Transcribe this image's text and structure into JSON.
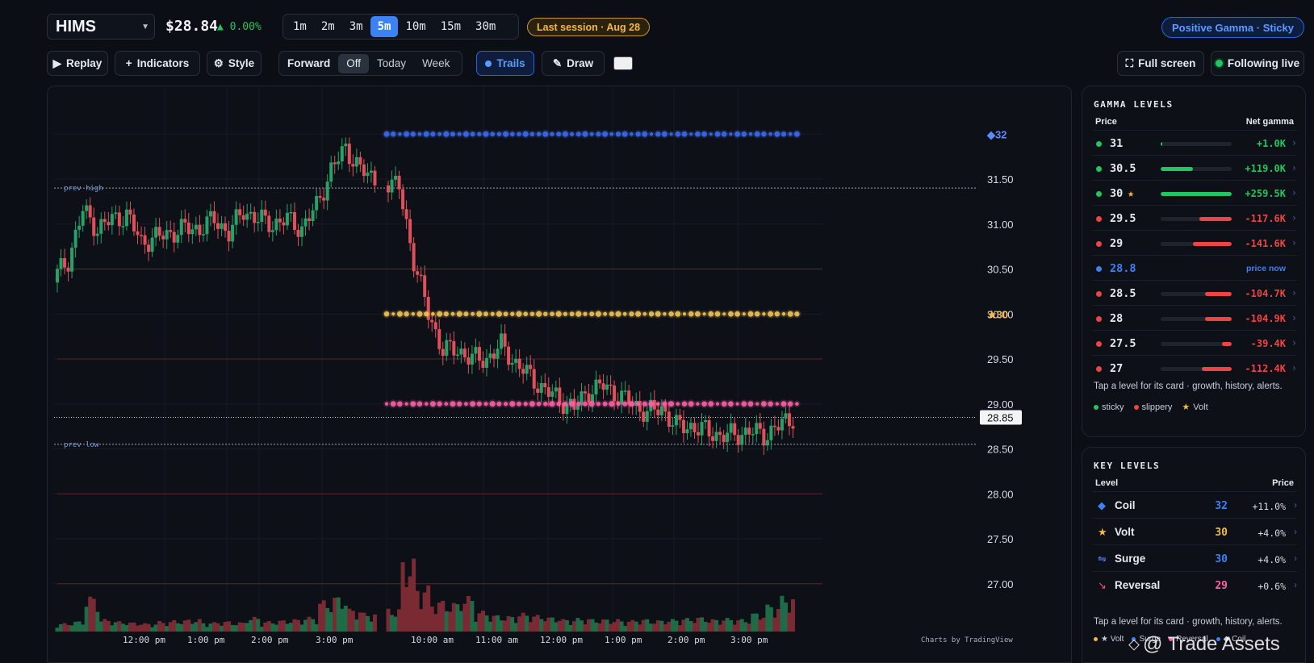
{
  "header": {
    "symbol": "HIMS",
    "price": "$28.84",
    "change": "▲ 0.00%",
    "timeframes": [
      "1m",
      "2m",
      "3m",
      "5m",
      "10m",
      "15m",
      "30m"
    ],
    "active_timeframe": "5m",
    "session_badge": "Last session · Aug 28",
    "regime_badge": "Positive Gamma · Sticky"
  },
  "toolbar": {
    "replay": "Replay",
    "indicators": "Indicators",
    "style": "Style",
    "forward_label": "Forward",
    "forward_options": [
      "Off",
      "Today",
      "Week"
    ],
    "forward_selected": "Off",
    "trails": "Trails",
    "draw": "Draw",
    "fullscreen": "Full screen",
    "following": "Following live"
  },
  "chart": {
    "attribution": "Charts by TradingView",
    "prev_high_label": "prev high",
    "prev_low_label": "prev low",
    "last_price_tag": "28.85",
    "level_tags": [
      {
        "text": "32",
        "prefix": "◆",
        "color": "#5b8cff"
      },
      {
        "text": "30",
        "prefix": "★",
        "color": "#f5b942"
      }
    ]
  },
  "chart_data": {
    "type": "candlestick",
    "price_axis_ticks": [
      "31.50",
      "31.00",
      "30.50",
      "30.00",
      "29.50",
      "29.00",
      "28.50",
      "28.00",
      "27.50",
      "27.00"
    ],
    "price_axis_values": [
      31.5,
      31.0,
      30.5,
      30.0,
      29.5,
      29.0,
      28.5,
      28.0,
      27.5,
      27.0
    ],
    "time_axis_labels": [
      "12:00 pm",
      "1:00 pm",
      "2:00 pm",
      "3:00 pm",
      "10:00 am",
      "11:00 am",
      "12:00 pm",
      "1:00 pm",
      "2:00 pm",
      "3:00 pm"
    ],
    "ylim": [
      26.5,
      32.6
    ],
    "prev_high": 31.4,
    "prev_low": 28.55,
    "last_price": 28.85,
    "gamma_trails": [
      {
        "name": "32",
        "price": 32.0,
        "color": "#3b6cf0"
      },
      {
        "name": "30",
        "price": 30.0,
        "color": "#f5c451"
      },
      {
        "name": "29",
        "price": 29.0,
        "color": "#ff5fa8"
      }
    ],
    "red_levels": [
      29.5,
      28.0,
      27.0
    ],
    "green_levels": [
      30.5
    ],
    "close_path": [
      30.4,
      30.6,
      31.15,
      30.95,
      31.05,
      31.1,
      30.8,
      30.85,
      30.9,
      30.95,
      30.95,
      31.05,
      30.9,
      31.15,
      31.05,
      31.0,
      31.05,
      30.95,
      31.2,
      31.6,
      31.85,
      31.6,
      31.5,
      31.4,
      30.6,
      30.0,
      29.6,
      29.6,
      29.5,
      29.5,
      29.65,
      29.45,
      29.3,
      29.15,
      29.05,
      28.95,
      29.15,
      29.2,
      29.1,
      29.0,
      28.9,
      28.95,
      28.75,
      28.75,
      28.7,
      28.65,
      28.65,
      28.7,
      28.65,
      28.75,
      28.85
    ],
    "volume_profile": [
      8,
      10,
      34,
      12,
      10,
      9,
      8,
      10,
      11,
      12,
      9,
      10,
      9,
      14,
      10,
      11,
      12,
      14,
      30,
      34,
      22,
      18,
      22,
      70,
      44,
      30,
      28,
      34,
      20,
      16,
      15,
      18,
      16,
      14,
      12,
      13,
      12,
      12,
      11,
      12,
      11,
      12,
      13,
      14,
      12,
      13,
      12,
      18,
      26,
      34,
      90
    ]
  },
  "gamma_levels": {
    "title": "GAMMA LEVELS",
    "col_price": "Price",
    "col_net": "Net gamma",
    "rows": [
      {
        "price": "31",
        "value": "+1.0K",
        "side": "pos",
        "fill": 0.02,
        "dot": "#22c55e",
        "star": false
      },
      {
        "price": "30.5",
        "value": "+119.0K",
        "side": "pos",
        "fill": 0.46,
        "dot": "#22c55e",
        "star": false
      },
      {
        "price": "30",
        "value": "+259.5K",
        "side": "pos",
        "fill": 1.0,
        "dot": "#22c55e",
        "star": true
      },
      {
        "price": "29.5",
        "value": "-117.6K",
        "side": "neg",
        "fill": 0.45,
        "dot": "#ef4444",
        "star": false
      },
      {
        "price": "29",
        "value": "-141.6K",
        "side": "neg",
        "fill": 0.55,
        "dot": "#ef4444",
        "star": false
      },
      {
        "price": "28.8",
        "value": "price now",
        "side": "now",
        "fill": 0,
        "dot": "#3b82f6",
        "star": false
      },
      {
        "price": "28.5",
        "value": "-104.7K",
        "side": "neg",
        "fill": 0.38,
        "dot": "#ef4444",
        "star": false
      },
      {
        "price": "28",
        "value": "-104.9K",
        "side": "neg",
        "fill": 0.38,
        "dot": "#ef4444",
        "star": false
      },
      {
        "price": "27.5",
        "value": "-39.4K",
        "side": "neg",
        "fill": 0.14,
        "dot": "#ef4444",
        "star": false
      },
      {
        "price": "27",
        "value": "-112.4K",
        "side": "neg",
        "fill": 0.42,
        "dot": "#ef4444",
        "star": false
      }
    ],
    "hint": "Tap a level for its card · growth, history, alerts.",
    "legend": [
      "sticky",
      "slippery",
      "Volt"
    ]
  },
  "key_levels": {
    "title": "KEY LEVELS",
    "col_level": "Level",
    "col_price": "Price",
    "rows": [
      {
        "name": "Coil",
        "price": "32",
        "pct": "+11.0%",
        "icon": "◆",
        "icon_color": "#3b82f6",
        "price_color": "#3b82f6"
      },
      {
        "name": "Volt",
        "price": "30",
        "pct": "+4.0%",
        "icon": "★",
        "icon_color": "#f5b942",
        "price_color": "#f5b942"
      },
      {
        "name": "Surge",
        "price": "30",
        "pct": "+4.0%",
        "icon": "⇋",
        "icon_color": "#5b8cff",
        "price_color": "#3b82f6"
      },
      {
        "name": "Reversal",
        "price": "29",
        "pct": "+0.6%",
        "icon": "↘",
        "icon_color": "#ff4d7a",
        "price_color": "#ff5fa8"
      }
    ],
    "hint": "Tap a level for its card · growth, history, alerts.",
    "legend": [
      "★ Volt",
      "Surge",
      "Reversal",
      "◆ Coil"
    ]
  },
  "watermark": "@ Trade Assets",
  "colors": {
    "up": "#26a269",
    "down": "#e0505a",
    "accent": "#3b82f6",
    "gold": "#f5b942",
    "pink": "#ff5fa8"
  }
}
